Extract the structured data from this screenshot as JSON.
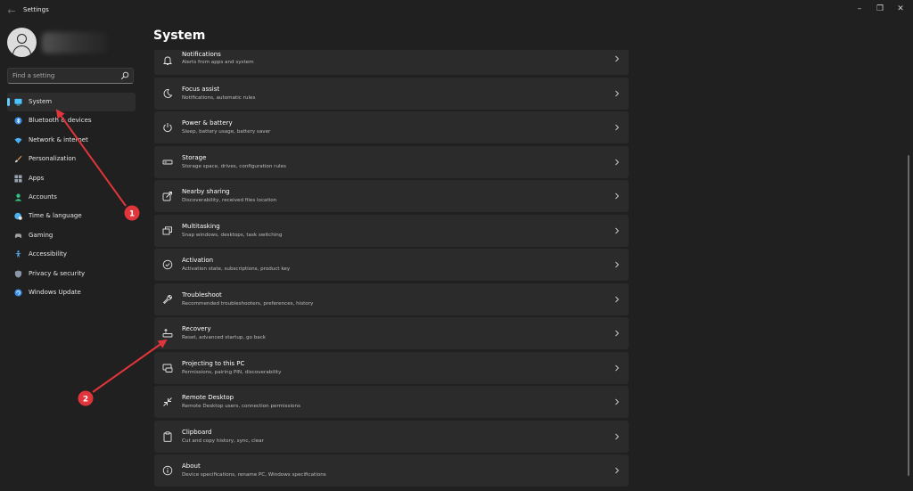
{
  "window": {
    "title": "Settings",
    "back_icon": "back-arrow-icon",
    "controls": [
      "minimize-icon",
      "restore-icon",
      "close-icon"
    ]
  },
  "search": {
    "placeholder": "Find a setting",
    "value": ""
  },
  "sidebar": {
    "items": [
      {
        "label": "System",
        "icon": "system-monitor-icon",
        "color": "#4cc2ff",
        "active": true
      },
      {
        "label": "Bluetooth & devices",
        "icon": "bluetooth-icon",
        "color": "#3a8ee6",
        "active": false
      },
      {
        "label": "Network & internet",
        "icon": "wifi-icon",
        "color": "#4cb0f0",
        "active": false
      },
      {
        "label": "Personalization",
        "icon": "brush-icon",
        "color": "#e8a254",
        "active": false
      },
      {
        "label": "Apps",
        "icon": "apps-icon",
        "color": "#9aa4b0",
        "active": false
      },
      {
        "label": "Accounts",
        "icon": "person-icon",
        "color": "#33c481",
        "active": false
      },
      {
        "label": "Time & language",
        "icon": "globe-clock-icon",
        "color": "#4cb0f0",
        "active": false
      },
      {
        "label": "Gaming",
        "icon": "gamepad-icon",
        "color": "#a0a0a0",
        "active": false
      },
      {
        "label": "Accessibility",
        "icon": "accessibility-icon",
        "color": "#5aaaf0",
        "active": false
      },
      {
        "label": "Privacy & security",
        "icon": "shield-icon",
        "color": "#8a96a8",
        "active": false
      },
      {
        "label": "Windows Update",
        "icon": "update-icon",
        "color": "#3a8ee6",
        "active": false
      }
    ]
  },
  "main": {
    "title": "System",
    "items": [
      {
        "title": "Notifications",
        "subtitle": "Alerts from apps and system",
        "icon": "bell-icon"
      },
      {
        "title": "Focus assist",
        "subtitle": "Notifications, automatic rules",
        "icon": "moon-icon"
      },
      {
        "title": "Power & battery",
        "subtitle": "Sleep, battery usage, battery saver",
        "icon": "power-icon"
      },
      {
        "title": "Storage",
        "subtitle": "Storage space, drives, configuration rules",
        "icon": "storage-icon"
      },
      {
        "title": "Nearby sharing",
        "subtitle": "Discoverability, received files location",
        "icon": "share-icon"
      },
      {
        "title": "Multitasking",
        "subtitle": "Snap windows, desktops, task switching",
        "icon": "multitask-icon"
      },
      {
        "title": "Activation",
        "subtitle": "Activation state, subscriptions, product key",
        "icon": "check-circle-icon"
      },
      {
        "title": "Troubleshoot",
        "subtitle": "Recommended troubleshooters, preferences, history",
        "icon": "wrench-icon"
      },
      {
        "title": "Recovery",
        "subtitle": "Reset, advanced startup, go back",
        "icon": "recovery-icon"
      },
      {
        "title": "Projecting to this PC",
        "subtitle": "Permissions, pairing PIN, discoverability",
        "icon": "projector-icon"
      },
      {
        "title": "Remote Desktop",
        "subtitle": "Remote Desktop users, connection permissions",
        "icon": "remote-desktop-icon"
      },
      {
        "title": "Clipboard",
        "subtitle": "Cut and copy history, sync, clear",
        "icon": "clipboard-icon"
      },
      {
        "title": "About",
        "subtitle": "Device specifications, rename PC, Windows specifications",
        "icon": "info-icon"
      }
    ]
  },
  "annotations": [
    {
      "label": "1",
      "color": "#e0353a"
    },
    {
      "label": "2",
      "color": "#e0353a"
    }
  ],
  "colors": {
    "accent": "#60cdff",
    "background": "#202020",
    "card": "#2b2b2b"
  }
}
